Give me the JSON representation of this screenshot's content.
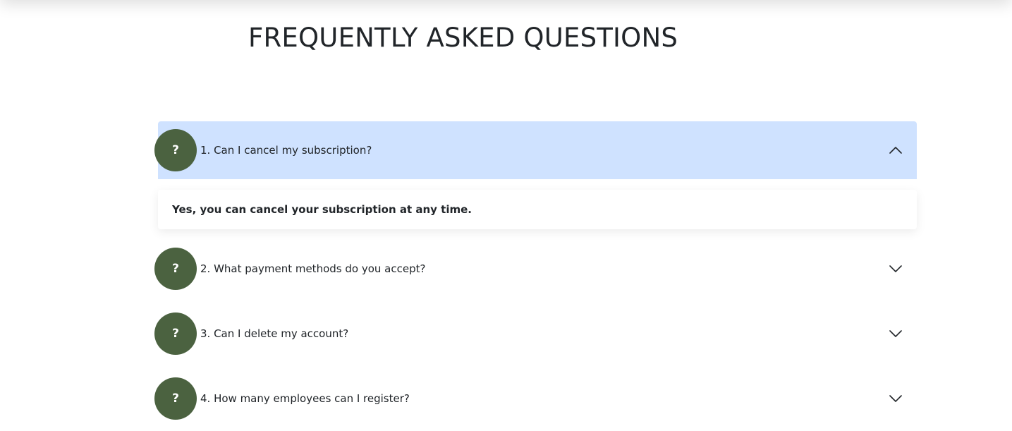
{
  "page": {
    "title": "FREQUENTLY ASKED QUESTIONS"
  },
  "faq": {
    "icon_glyph": "?",
    "items": [
      {
        "question": "1. Can I cancel my subscription?",
        "answer": "Yes, you can cancel your subscription at any time.",
        "expanded": true
      },
      {
        "question": "2. What payment methods do you accept?",
        "expanded": false
      },
      {
        "question": "3. Can I delete my account?",
        "expanded": false
      },
      {
        "question": "4. How many employees can I register?",
        "expanded": false
      }
    ]
  },
  "colors": {
    "accent_circle": "#4b6240",
    "active_header_bg": "#cfe2ff",
    "text": "#212529"
  }
}
